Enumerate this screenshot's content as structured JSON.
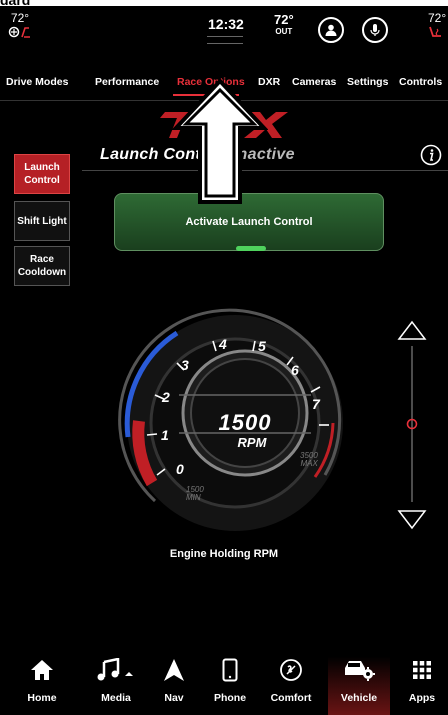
{
  "clipped_heading": "dard",
  "status": {
    "driver_temp": "72°",
    "passenger_temp": "72°",
    "clock": "12:32",
    "outside_temp": "72°",
    "outside_label": "OUT",
    "icons": [
      "seat-heat-icon",
      "profile-icon",
      "microphone-icon",
      "seat-heat-passenger-icon"
    ]
  },
  "tabs": [
    {
      "label": "Drive Modes"
    },
    {
      "label": "Performance"
    },
    {
      "label": "Race Options",
      "active": true
    },
    {
      "label": "DXR"
    },
    {
      "label": "Cameras"
    },
    {
      "label": "Settings"
    },
    {
      "label": "Controls"
    }
  ],
  "side_menu": [
    {
      "label": "Launch Control",
      "active": true
    },
    {
      "label": "Shift Light"
    },
    {
      "label": "Race Cooldown"
    }
  ],
  "launch_control": {
    "title": "Launch Control:",
    "state": "Inactive",
    "activate_label": "Activate Launch Control"
  },
  "gauge": {
    "rpm_value": "1500",
    "rpm_unit": "RPM",
    "ticks": [
      "0",
      "1",
      "2",
      "3",
      "4",
      "5",
      "6",
      "7"
    ],
    "min_value": "1500",
    "min_label": "MIN",
    "max_value": "3500",
    "max_label": "MAX"
  },
  "slider": {
    "value_fraction": 0.5
  },
  "engine_label": "Engine Holding RPM",
  "nav": [
    {
      "label": "Home",
      "icon": "home-icon"
    },
    {
      "label": "Media",
      "icon": "music-note-icon"
    },
    {
      "label": "Nav",
      "icon": "navigation-arrow-icon"
    },
    {
      "label": "Phone",
      "icon": "phone-icon"
    },
    {
      "label": "Comfort",
      "icon": "comfort-icon"
    },
    {
      "label": "Vehicle",
      "icon": "vehicle-icon",
      "active": true
    },
    {
      "label": "Apps",
      "icon": "apps-grid-icon"
    }
  ],
  "colors": {
    "accent": "#e8303a",
    "active_bg": "#b52025",
    "green": "#2e6a34",
    "gauge_blue": "#2a5bd7"
  }
}
